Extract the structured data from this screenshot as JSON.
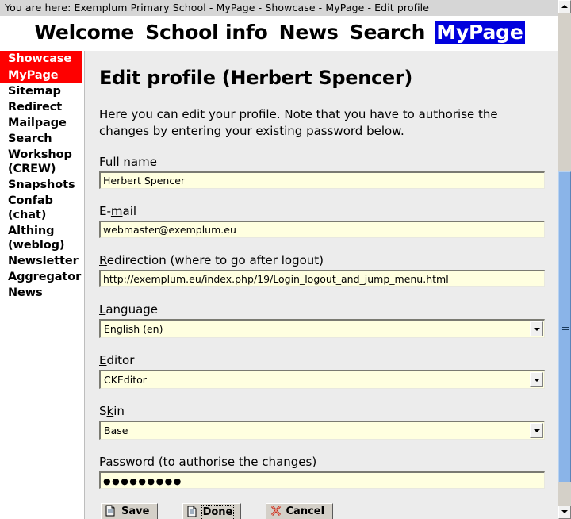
{
  "breadcrumb": {
    "text": "You are here: Exemplum Primary School - MyPage - Showcase - MyPage - Edit profile"
  },
  "topnav": {
    "items": [
      {
        "label": "Welcome",
        "current": false
      },
      {
        "label": "School info",
        "current": false
      },
      {
        "label": "News",
        "current": false
      },
      {
        "label": "Search",
        "current": false
      },
      {
        "label": "MyPage",
        "current": true
      }
    ],
    "current_bg": "#0000dd",
    "current_fg": "#ffffff"
  },
  "sidebar": {
    "highlight_bg": "#fe0000",
    "highlight_fg": "#ffffff",
    "items": [
      {
        "label": "Showcase",
        "highlighted": true
      },
      {
        "label": "MyPage",
        "highlighted": true
      },
      {
        "label": "Sitemap",
        "highlighted": false
      },
      {
        "label": "Redirect",
        "highlighted": false
      },
      {
        "label": "Mailpage",
        "highlighted": false
      },
      {
        "label": "Search",
        "highlighted": false
      },
      {
        "label": "Workshop (CREW)",
        "highlighted": false
      },
      {
        "label": "Snapshots",
        "highlighted": false
      },
      {
        "label": "Confab (chat)",
        "highlighted": false
      },
      {
        "label": "Althing (weblog)",
        "highlighted": false
      },
      {
        "label": "Newsletter",
        "highlighted": false
      },
      {
        "label": "Aggregator",
        "highlighted": false
      },
      {
        "label": "News",
        "highlighted": false
      }
    ]
  },
  "main": {
    "title": "Edit profile (Herbert Spencer)",
    "intro": "Here you can edit your profile. Note that you have to authorise the changes by entering your existing password below.",
    "fields": {
      "fullname": {
        "label_pre": "",
        "label_key": "F",
        "label_post": "ull name",
        "value": "Herbert Spencer"
      },
      "email": {
        "label_pre": "E-",
        "label_key": "m",
        "label_post": "ail",
        "value": "webmaster@exemplum.eu"
      },
      "redirection": {
        "label_pre": "",
        "label_key": "R",
        "label_post": "edirection (where to go after logout)",
        "value": "http://exemplum.eu/index.php/19/Login_logout_and_jump_menu.html"
      },
      "language": {
        "label_pre": "",
        "label_key": "L",
        "label_post": "anguage",
        "value": "English (en)"
      },
      "editor": {
        "label_pre": "",
        "label_key": "E",
        "label_post": "ditor",
        "value": "CKEditor"
      },
      "skin": {
        "label_pre": "S",
        "label_key": "k",
        "label_post": "in",
        "value": "Base"
      },
      "password": {
        "label_pre": "",
        "label_key": "P",
        "label_post": "assword (to authorise the changes)",
        "value": "●●●●●●●●●"
      }
    },
    "buttons": [
      {
        "label": "Save",
        "icon": "document-icon",
        "focused": false
      },
      {
        "label": "Done",
        "icon": "document-icon",
        "focused": true
      },
      {
        "label": "Cancel",
        "icon": "red-x-icon",
        "focused": false
      }
    ]
  },
  "scrollbar": {
    "up_icon": "chevron-up-icon",
    "down_icon": "chevron-down-icon",
    "thumb_color": "#8ab4e8"
  },
  "colors": {
    "field_bg": "#ffffe0",
    "content_bg": "#ececec",
    "breadcrumb_bg": "#d6d6d6"
  }
}
